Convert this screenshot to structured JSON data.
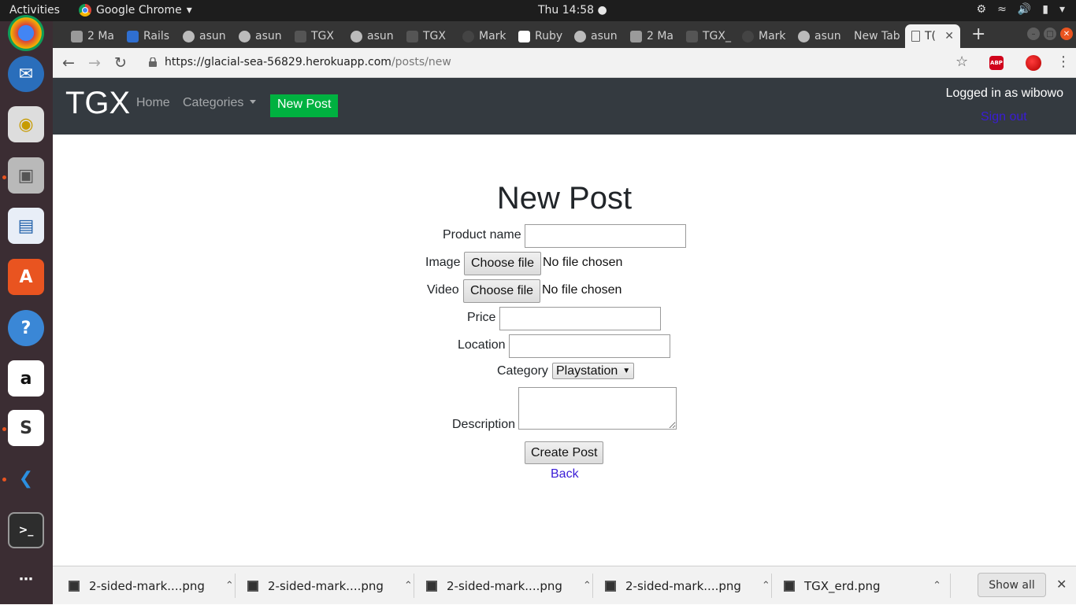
{
  "system": {
    "activities": "Activities",
    "app_name": "Google Chrome",
    "clock": "Thu 14:58 ●"
  },
  "tabs": [
    {
      "label": "2 Ma"
    },
    {
      "label": "Rails"
    },
    {
      "label": "asun"
    },
    {
      "label": "asun"
    },
    {
      "label": "TGX"
    },
    {
      "label": "asun"
    },
    {
      "label": "TGX"
    },
    {
      "label": "Mark"
    },
    {
      "label": "Ruby"
    },
    {
      "label": "asun"
    },
    {
      "label": "2 Ma"
    },
    {
      "label": "TGX_"
    },
    {
      "label": "Mark"
    },
    {
      "label": "asun"
    },
    {
      "label": "New Tab"
    },
    {
      "label": "T("
    }
  ],
  "browser": {
    "url_host": "https://glacial-sea-56829.herokuapp.com",
    "url_path": "/posts/new",
    "abp_label": "ABP"
  },
  "site": {
    "brand": "TGX",
    "nav_home": "Home",
    "nav_categories": "Categories",
    "nav_new_post": "New Post",
    "logged_in": "Logged in as wibowo",
    "sign_out": "Sign out"
  },
  "form": {
    "title": "New Post",
    "product_name_label": "Product name",
    "product_name_value": "",
    "image_label": "Image",
    "image_button": "Choose file",
    "image_status": "No file chosen",
    "video_label": "Video",
    "video_button": "Choose file",
    "video_status": "No file chosen",
    "price_label": "Price",
    "price_value": "",
    "location_label": "Location",
    "location_value": "",
    "category_label": "Category",
    "category_selected": "Playstation",
    "description_label": "Description",
    "description_value": "",
    "submit_label": "Create Post",
    "back_label": "Back"
  },
  "downloads": {
    "items": [
      {
        "name": "2-sided-mark....png"
      },
      {
        "name": "2-sided-mark....png"
      },
      {
        "name": "2-sided-mark....png"
      },
      {
        "name": "2-sided-mark....png"
      },
      {
        "name": "TGX_erd.png"
      }
    ],
    "show_all": "Show all"
  },
  "colors": {
    "navbar": "#343a40",
    "new_post_button": "#00b140",
    "link": "#3a1cd6",
    "dock": "#3b2d33",
    "ubuntu_orange": "#e95420"
  }
}
